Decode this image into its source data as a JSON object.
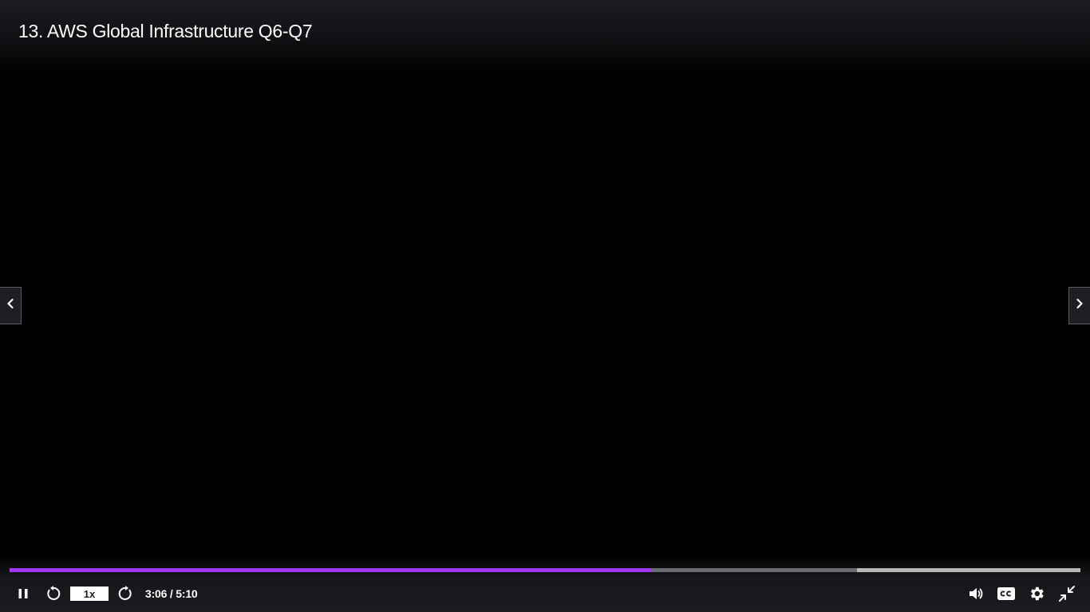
{
  "player": {
    "title": "13. AWS Global Infrastructure Q6-Q7",
    "speed_label": "1x",
    "time_label": "3:06 / 5:10",
    "progress_fraction": 0.6,
    "buffered_fraction": 0.791,
    "remaining_light_fraction": 0.209
  },
  "icons": {
    "prev": "chevron-left-icon",
    "next": "chevron-right-icon",
    "pause": "pause-icon",
    "rewind": "rewind-icon",
    "forward": "forward-icon",
    "volume": "volume-icon",
    "captions": "captions-icon",
    "settings": "gear-icon",
    "exit_fullscreen": "exit-fullscreen-icon"
  },
  "colors": {
    "accent": "#a435f0",
    "background": "#000000",
    "control_bar": "#1b1c20",
    "text": "#ffffff"
  }
}
